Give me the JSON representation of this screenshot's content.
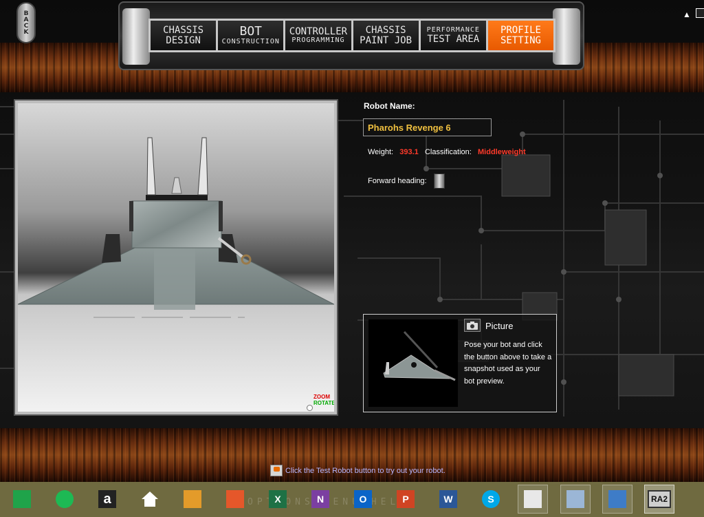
{
  "back_button": {
    "label": "BACK"
  },
  "nav_tabs": [
    {
      "line1": "CHASSIS",
      "line2": "DESIGN",
      "active": false
    },
    {
      "line1": "BOT",
      "line2": "CONSTRUCTION",
      "active": false
    },
    {
      "line1": "CONTROLLER",
      "line2": "PROGRAMMING",
      "active": false
    },
    {
      "line1": "CHASSIS",
      "line2": "PAINT JOB",
      "active": false
    },
    {
      "line1": "PERFORMANCE",
      "line2": "TEST AREA",
      "active": false
    },
    {
      "line1": "PROFILE",
      "line2": "SETTING",
      "active": true
    }
  ],
  "viewport": {
    "zoom_label": "ZOOM",
    "rotate_label": "ROTATE"
  },
  "profile": {
    "robot_name_label": "Robot Name:",
    "robot_name_value": "Pharohs Revenge 6",
    "weight_label": "Weight:",
    "weight_value": "393.1",
    "classification_label": "Classification:",
    "classification_value": "Middleweight",
    "heading_label": "Forward heading:"
  },
  "picture": {
    "title": "Picture",
    "description": "Pose your bot and click the button above to take a snapshot used as your bot preview."
  },
  "hint": {
    "text": "Click the Test Robot button to try out your robot."
  },
  "taskbar": {
    "ghost_text": "OPTIONS  MENU  HELP",
    "apps": [
      {
        "icon": "store-icon",
        "color": "#1fa34a",
        "glyph": ""
      },
      {
        "icon": "spotify-icon",
        "color": "#1db954",
        "glyph": ""
      },
      {
        "icon": "amazon-icon",
        "color": "#222222",
        "glyph": "a"
      },
      {
        "icon": "home-icon",
        "color": "#ffffff",
        "glyph": ""
      },
      {
        "icon": "files-icon",
        "color": "#e39b2a",
        "glyph": ""
      },
      {
        "icon": "photos-icon",
        "color": "#e5572a",
        "glyph": ""
      },
      {
        "icon": "excel-icon",
        "color": "#1e7145",
        "glyph": "X"
      },
      {
        "icon": "onenote-icon",
        "color": "#7b3fa1",
        "glyph": "N"
      },
      {
        "icon": "outlook-icon",
        "color": "#0a64c8",
        "glyph": "O"
      },
      {
        "icon": "powerpoint-icon",
        "color": "#d04423",
        "glyph": "P"
      },
      {
        "icon": "word-icon",
        "color": "#2b5797",
        "glyph": "W"
      },
      {
        "icon": "skype-icon",
        "color": "#00a8e8",
        "glyph": "S"
      },
      {
        "icon": "notepad-icon",
        "color": "#e8e8e8",
        "glyph": ""
      },
      {
        "icon": "remote-desktop-icon",
        "color": "#9bb6d6",
        "glyph": ""
      },
      {
        "icon": "hub-icon",
        "color": "#3e7cc7",
        "glyph": ""
      },
      {
        "icon": "ra2-icon",
        "color": "#cfcfcf",
        "glyph": "RA2"
      }
    ]
  }
}
